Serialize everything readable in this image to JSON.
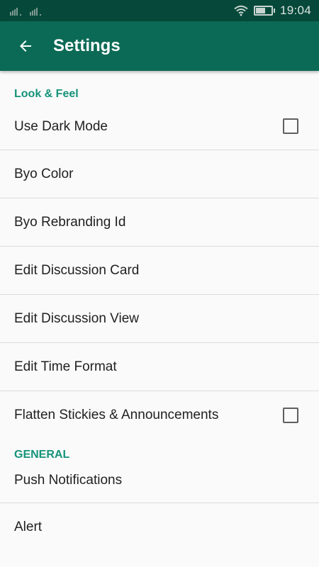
{
  "status_bar": {
    "time": "19:04",
    "icons": [
      "signal-icon",
      "signal-icon",
      "wifi-icon",
      "battery-icon"
    ]
  },
  "toolbar": {
    "back_icon": "arrow-left-icon",
    "title": "Settings"
  },
  "sections": [
    {
      "header": "Look & Feel",
      "items": [
        {
          "label": "Use Dark Mode",
          "checkbox": true,
          "checked": false
        },
        {
          "label": "Byo Color"
        },
        {
          "label": "Byo Rebranding Id"
        },
        {
          "label": "Edit Discussion Card"
        },
        {
          "label": "Edit Discussion View"
        },
        {
          "label": "Edit Time Format"
        },
        {
          "label": "Flatten Stickies & Announcements",
          "checkbox": true,
          "checked": false
        }
      ]
    },
    {
      "header": "GENERAL",
      "items": [
        {
          "label": "Push Notifications"
        },
        {
          "label": "Alert"
        }
      ]
    }
  ],
  "colors": {
    "status_bar": "#06493a",
    "toolbar": "#0b6a55",
    "accent": "#15937a",
    "background": "#fafafa",
    "divider": "#dcdcdc"
  }
}
